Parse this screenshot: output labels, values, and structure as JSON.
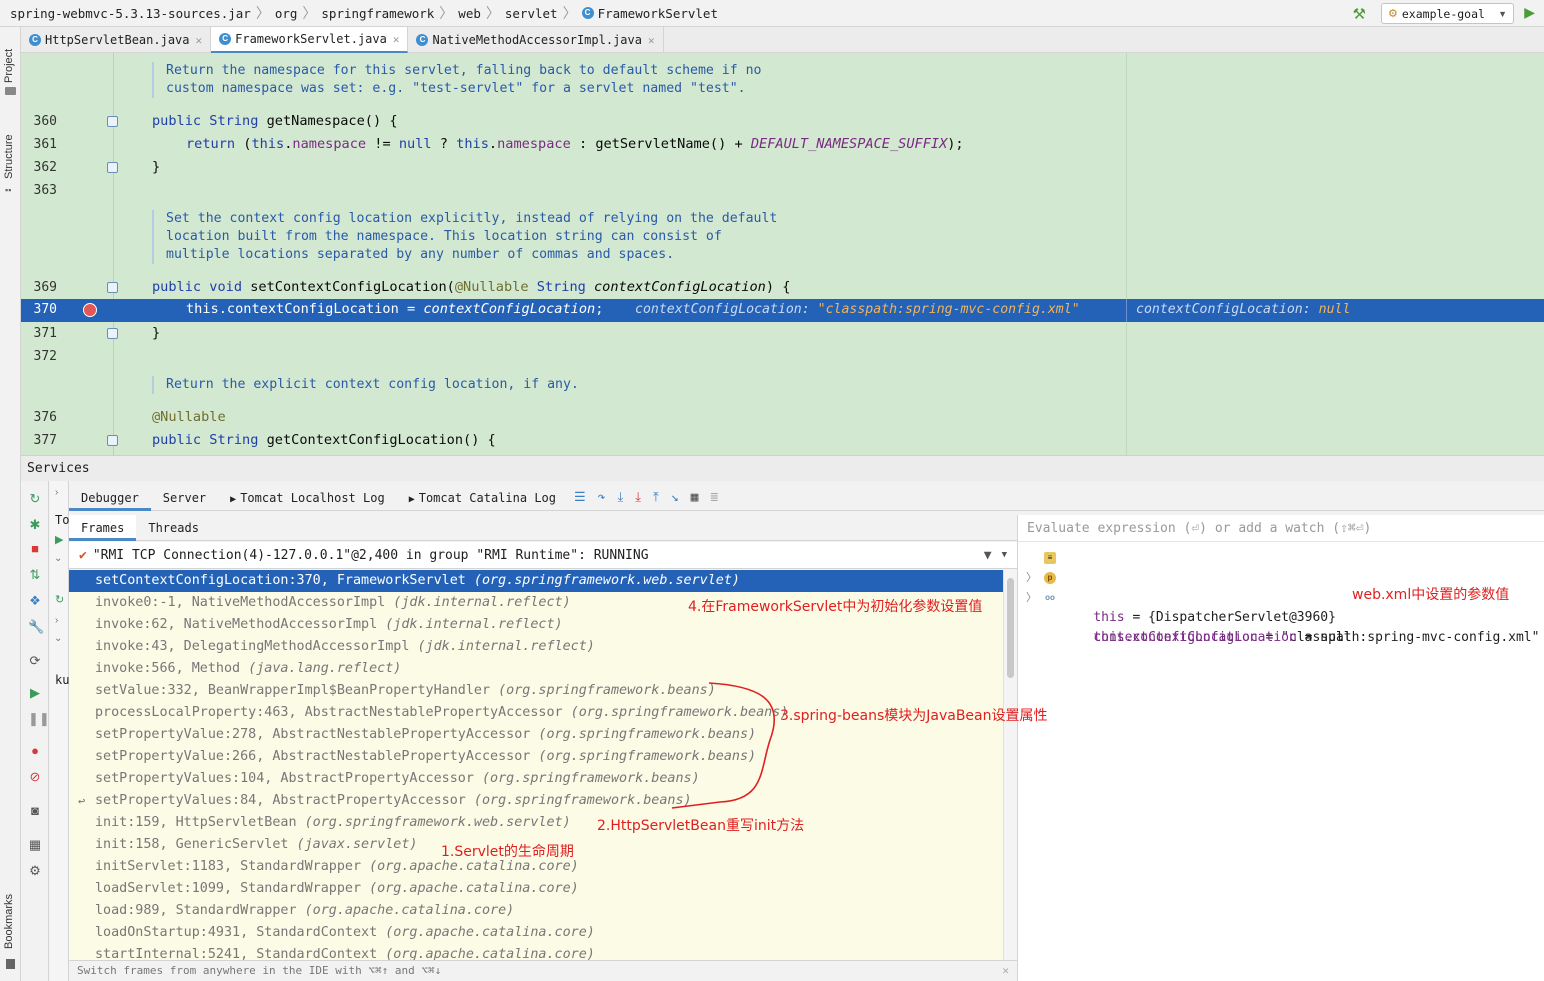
{
  "breadcrumb": [
    "spring-webmvc-5.3.13-sources.jar",
    "org",
    "springframework",
    "web",
    "servlet",
    "FrameworkServlet"
  ],
  "run_config": {
    "label": "example-goal"
  },
  "left_strip": {
    "project": "Project",
    "structure": "Structure",
    "bookmarks": "Bookmarks"
  },
  "editor_tabs": [
    {
      "label": "HttpServletBean.java",
      "active": false
    },
    {
      "label": "FrameworkServlet.java",
      "active": true
    },
    {
      "label": "NativeMethodAccessorImpl.java",
      "active": false
    }
  ],
  "editor": {
    "doc1": [
      "Return the namespace for this servlet, falling back to default scheme if no",
      "custom namespace was set: e.g. \"test-servlet\" for a servlet named \"test\"."
    ],
    "doc2": [
      "Set the context config location explicitly, instead of relying on the default",
      "location built from the namespace. This location string can consist of",
      "multiple locations separated by any number of commas and spaces."
    ],
    "doc3": [
      "Return the explicit context config location, if any."
    ],
    "line_numbers": {
      "l360": "360",
      "l361": "361",
      "l362": "362",
      "l363": "363",
      "l369": "369",
      "l370": "370",
      "l371": "371",
      "l372": "372",
      "l376": "376",
      "l377": "377"
    },
    "code": {
      "c360": "public String getNamespace() {",
      "c361": "return (this.namespace != null ? this.namespace : getServletName() + DEFAULT_NAMESPACE_SUFFIX);",
      "c362": "}",
      "c369": "public void setContextConfigLocation(@Nullable String contextConfigLocation) {",
      "c370": "this.contextConfigLocation = contextConfigLocation;",
      "c371": "}",
      "c376": "@Nullable",
      "c377": "public String getContextConfigLocation() {"
    },
    "inline_value_1_name": "contextConfigLocation: ",
    "inline_value_1_value": "\"classpath:spring-mvc-config.xml\"",
    "inline_value_2_name": "contextConfigLocation: ",
    "inline_value_2_value": "null"
  },
  "services": {
    "title": "Services",
    "tree_partial_1": "To",
    "tree_partial_2": "ku"
  },
  "debugger_tabs": [
    "Debugger",
    "Server",
    "Tomcat Localhost Log",
    "Tomcat Catalina Log"
  ],
  "frames_tabs": [
    "Frames",
    "Threads"
  ],
  "thread": "\"RMI TCP Connection(4)-127.0.0.1\"@2,400 in group \"RMI Runtime\": RUNNING",
  "frames": [
    {
      "method": "setContextConfigLocation:370, FrameworkServlet",
      "pkg": "(org.springframework.web.servlet)"
    },
    {
      "method": "invoke0:-1, NativeMethodAccessorImpl",
      "pkg": "(jdk.internal.reflect)"
    },
    {
      "method": "invoke:62, NativeMethodAccessorImpl",
      "pkg": "(jdk.internal.reflect)"
    },
    {
      "method": "invoke:43, DelegatingMethodAccessorImpl",
      "pkg": "(jdk.internal.reflect)"
    },
    {
      "method": "invoke:566, Method",
      "pkg": "(java.lang.reflect)"
    },
    {
      "method": "setValue:332, BeanWrapperImpl$BeanPropertyHandler",
      "pkg": "(org.springframework.beans)"
    },
    {
      "method": "processLocalProperty:463, AbstractNestablePropertyAccessor",
      "pkg": "(org.springframework.beans)"
    },
    {
      "method": "setPropertyValue:278, AbstractNestablePropertyAccessor",
      "pkg": "(org.springframework.beans)"
    },
    {
      "method": "setPropertyValue:266, AbstractNestablePropertyAccessor",
      "pkg": "(org.springframework.beans)"
    },
    {
      "method": "setPropertyValues:104, AbstractPropertyAccessor",
      "pkg": "(org.springframework.beans)"
    },
    {
      "method": "setPropertyValues:84, AbstractPropertyAccessor",
      "pkg": "(org.springframework.beans)"
    },
    {
      "method": "init:159, HttpServletBean",
      "pkg": "(org.springframework.web.servlet)"
    },
    {
      "method": "init:158, GenericServlet",
      "pkg": "(javax.servlet)"
    },
    {
      "method": "initServlet:1183, StandardWrapper",
      "pkg": "(org.apache.catalina.core)"
    },
    {
      "method": "loadServlet:1099, StandardWrapper",
      "pkg": "(org.apache.catalina.core)"
    },
    {
      "method": "load:989, StandardWrapper",
      "pkg": "(org.apache.catalina.core)"
    },
    {
      "method": "loadOnStartup:4931, StandardContext",
      "pkg": "(org.apache.catalina.core)"
    },
    {
      "method": "startInternal:5241, StandardContext",
      "pkg": "(org.apache.catalina.core)"
    }
  ],
  "frames_footer": "Switch frames from anywhere in the IDE with ⌥⌘↑ and ⌥⌘↓",
  "variables": {
    "eval_placeholder": "Evaluate expression (⏎) or add a watch (⇧⌘⏎)",
    "items": [
      {
        "name": "this",
        "value": " = {DispatcherServlet@3960}"
      },
      {
        "name": "contextConfigLocation",
        "value": " = \"classpath:spring-mvc-config.xml\""
      },
      {
        "name": "this.contextConfigLocation",
        "value": " = null"
      }
    ]
  },
  "annotations": {
    "note1": "1.Servlet的生命周期",
    "note2": "2.HttpServletBean重写init方法",
    "note3": "3.spring-beans模块为JavaBean设置属性",
    "note4": "4.在FrameworkServlet中为初始化参数设置值",
    "note5": "web.xml中设置的参数值"
  },
  "colors": {
    "selection": "#2462b8",
    "editor_bg": "#d3e8d1",
    "frames_bg": "#fbfbe6",
    "annotation": "#e02020"
  }
}
